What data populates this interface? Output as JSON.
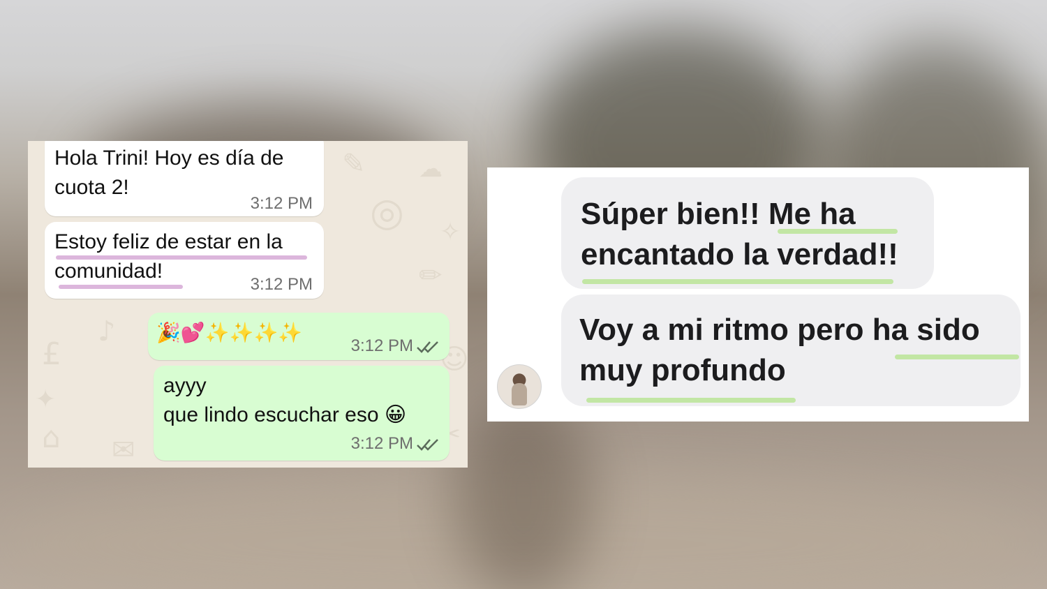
{
  "left_chat": {
    "messages": [
      {
        "direction": "incoming",
        "text": "Hola Trini! Hoy es día de\ncuota 2!",
        "time": "3:12 PM"
      },
      {
        "direction": "incoming",
        "text": "Estoy feliz de estar en la\ncomunidad!",
        "time": "3:12 PM"
      },
      {
        "direction": "outgoing",
        "text": "🎉💕✨✨✨✨",
        "time": "3:12 PM",
        "status": "read-double-check-icon"
      },
      {
        "direction": "outgoing",
        "text": "ayyy\nque lindo escuchar eso 😀",
        "time": "3:12 PM",
        "status": "read-double-check-icon"
      }
    ],
    "colors": {
      "incoming": "#ffffff",
      "outgoing": "#d8fdd2",
      "wallpaper": "#efe8dd",
      "highlight": "#dcb6dc"
    }
  },
  "right_chat": {
    "messages": [
      {
        "text": "Súper bien!! Me ha\nencantado la verdad!!"
      },
      {
        "text": "Voy a mi ritmo pero ha sido\nmuy profundo"
      }
    ],
    "avatar": "user-avatar",
    "colors": {
      "bubble": "#efeff1",
      "highlight": "#c2e6a4"
    }
  }
}
